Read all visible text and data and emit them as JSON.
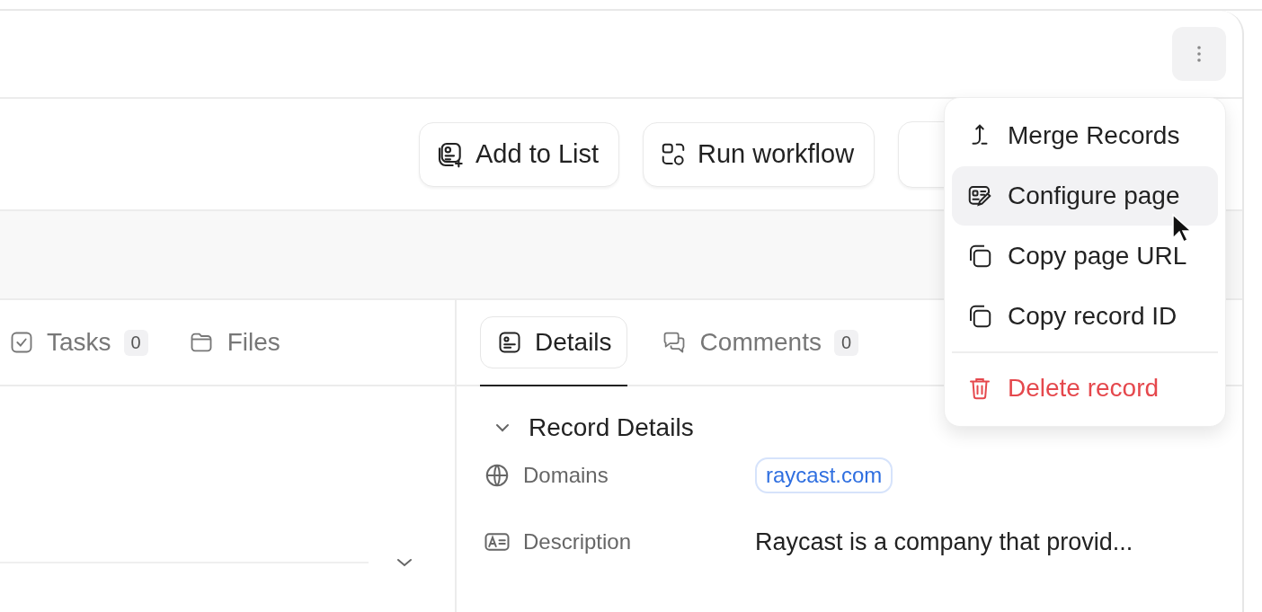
{
  "toolbar": {
    "buttons": [
      {
        "label": "Add to List",
        "kind": "list"
      },
      {
        "label": "Run workflow",
        "kind": "workflow"
      }
    ]
  },
  "menu": {
    "items": [
      {
        "label": "Merge Records",
        "kind": "merge",
        "selected": false
      },
      {
        "label": "Configure page",
        "kind": "configure",
        "selected": true
      },
      {
        "label": "Copy page URL",
        "kind": "copy",
        "selected": false
      },
      {
        "label": "Copy record ID",
        "kind": "copy",
        "selected": false
      },
      {
        "label": "Delete record",
        "kind": "delete",
        "selected": false
      }
    ]
  },
  "left_tabs": [
    {
      "label": "Tasks",
      "kind": "tasks",
      "count": "0",
      "selected": false
    },
    {
      "label": "Files",
      "kind": "files",
      "selected": false
    }
  ],
  "right_tabs": [
    {
      "label": "Details",
      "kind": "details",
      "selected": true
    },
    {
      "label": "Comments",
      "kind": "comments",
      "count": "0",
      "selected": false
    }
  ],
  "section": {
    "title": "Record Details",
    "expanded": true
  },
  "fields": [
    {
      "label": "Domains",
      "kind": "link",
      "value": "raycast.com"
    },
    {
      "label": "Description",
      "kind": "text",
      "value": "Raycast is a company that provid..."
    }
  ]
}
